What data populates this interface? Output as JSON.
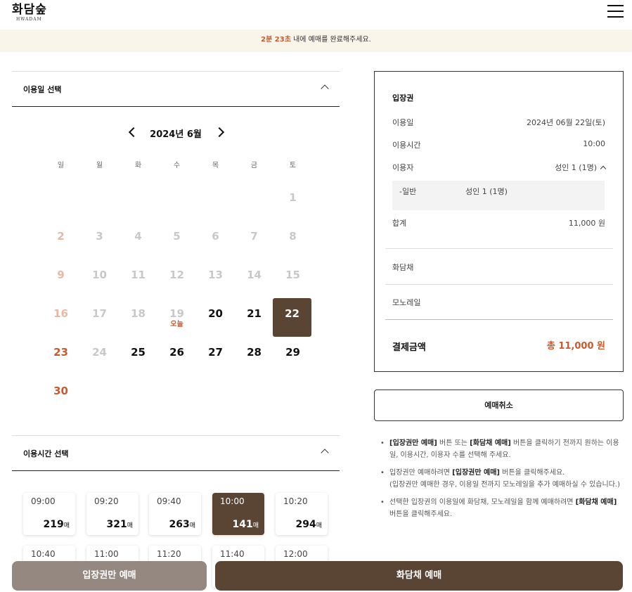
{
  "header": {
    "logo_main": "화담숲",
    "logo_sub": "HWADAM"
  },
  "timer": {
    "time": "2분 23초",
    "message": " 내에 예매를 완료해주세요."
  },
  "date_section": {
    "title": "이용일 선택"
  },
  "calendar": {
    "month_label": "2024년 6월",
    "weekdays": [
      "일",
      "월",
      "화",
      "수",
      "목",
      "금",
      "토"
    ],
    "days": [
      "1",
      "2",
      "3",
      "4",
      "5",
      "6",
      "7",
      "8",
      "9",
      "10",
      "11",
      "12",
      "13",
      "14",
      "15",
      "16",
      "17",
      "18",
      "19",
      "20",
      "21",
      "22",
      "23",
      "24",
      "25",
      "26",
      "27",
      "28",
      "29",
      "30"
    ],
    "today_label": "오늘",
    "selected_day": "22"
  },
  "time_section": {
    "title": "이용시간 선택"
  },
  "slots": [
    {
      "time": "09:00",
      "count": "219",
      "unit": "매"
    },
    {
      "time": "09:20",
      "count": "321",
      "unit": "매"
    },
    {
      "time": "09:40",
      "count": "263",
      "unit": "매"
    },
    {
      "time": "10:00",
      "count": "141",
      "unit": "매"
    },
    {
      "time": "10:20",
      "count": "294",
      "unit": "매"
    },
    {
      "time": "10:40"
    },
    {
      "time": "11:00"
    },
    {
      "time": "11:20"
    },
    {
      "time": "11:40"
    },
    {
      "time": "12:00"
    }
  ],
  "summary": {
    "title": "입장권",
    "date_label": "이용일",
    "date_value": "2024년 06월 22일(토)",
    "time_label": "이용시간",
    "time_value": "10:00",
    "user_label": "이용자",
    "user_value": "성인 1 (1명)",
    "sub_label": "-일반",
    "sub_value": "성인 1 (1명)",
    "total_label": "합계",
    "total_value": "11,000 원",
    "teahouse_label": "화담채",
    "monorail_label": "모노레일",
    "payment_label": "결제금액",
    "payment_value": "총 11,000 원"
  },
  "cancel_button": "예매취소",
  "notes": {
    "n1_a": "[입장권만 예매]",
    "n1_b": " 버튼 또는 ",
    "n1_c": "[화담채 예매]",
    "n1_d": " 버튼을 클릭하기 전까지 원하는 이용일, 이용시간, 이용자 수를 선택해 주세요.",
    "n2_a": "입장권만 예매하려면 ",
    "n2_b": "[입장권만 예매]",
    "n2_c": " 버튼을 클릭해주세요.",
    "n2_d": "(입장권만 예매한 경우, 이용일 전까지 모노레일을 추가 예매하실 수 있습니다.)",
    "n3_a": "선택한 입장권의 이용일에 화담채, 모노레일을 함께 예매하려면 ",
    "n3_b": "[화담채 예매]",
    "n3_c": " 버튼을 클릭해주세요."
  },
  "buttons": {
    "ticket_only": "입장권만 예매",
    "teahouse": "화담채 예매"
  }
}
